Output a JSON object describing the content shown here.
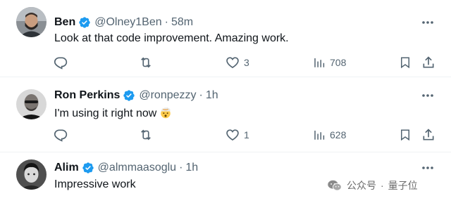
{
  "colors": {
    "verified": "#1d9bf0",
    "muted": "#536471",
    "text": "#0f1419",
    "divider": "#eff3f4"
  },
  "tweets": [
    {
      "name": "Ben",
      "handle": "@Olney1Ben",
      "dot": "·",
      "time": "58m",
      "text": "Look at that code improvement. Amazing work.",
      "emoji": "",
      "likes": "3",
      "views": "708",
      "reply_count": "",
      "retweet_count": ""
    },
    {
      "name": "Ron Perkins",
      "handle": "@ronpezzy",
      "dot": "·",
      "time": "1h",
      "text": "I'm using it right now",
      "emoji": "exploding-head-emoji",
      "likes": "1",
      "views": "628",
      "reply_count": "",
      "retweet_count": ""
    },
    {
      "name": "Alim",
      "handle": "@almmaasoglu",
      "dot": "·",
      "time": "1h",
      "text": "Impressive work",
      "emoji": ""
    }
  ],
  "watermark": {
    "icon": "wechat-icon",
    "source": "公众号",
    "separator": "·",
    "brand": "量子位"
  }
}
